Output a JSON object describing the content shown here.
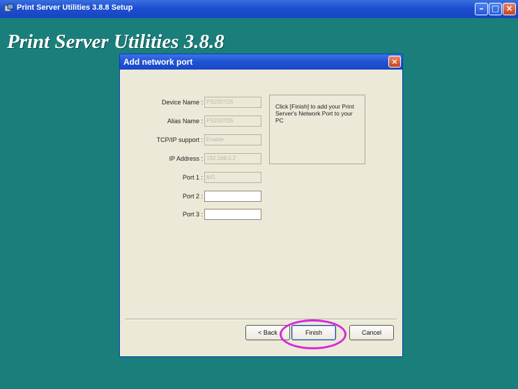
{
  "outer_window": {
    "title": "Print Server Utilities 3.8.8 Setup",
    "heading": "Print Server Utilities 3.8.8",
    "minimize_glyph": "–",
    "maximize_glyph": "□",
    "close_glyph": "×",
    "icon": "setup-icon"
  },
  "dialog": {
    "title": "Add network port",
    "close_glyph": "×",
    "fields": [
      {
        "label": "Device Name :",
        "value": "PS2007D5"
      },
      {
        "label": "Alias Name :",
        "value": "PS2007D5"
      },
      {
        "label": "TCP/IP support :",
        "value": "Enable"
      },
      {
        "label": "IP Address :",
        "value": "192.168.0.2"
      },
      {
        "label": "Port 1 :",
        "value": "lpt1"
      },
      {
        "label": "Port 2 :",
        "value": ""
      },
      {
        "label": "Port 3 :",
        "value": ""
      }
    ],
    "info_text": "Click [Finish] to add your Print Server's Network Port to your PC",
    "buttons": {
      "back": "< Back",
      "finish": "Finish",
      "cancel": "Cancel"
    }
  },
  "colors": {
    "desktop": "#1a7f7b",
    "highlight_circle": "#d42ad8",
    "titlebar": "#1f52d4"
  }
}
